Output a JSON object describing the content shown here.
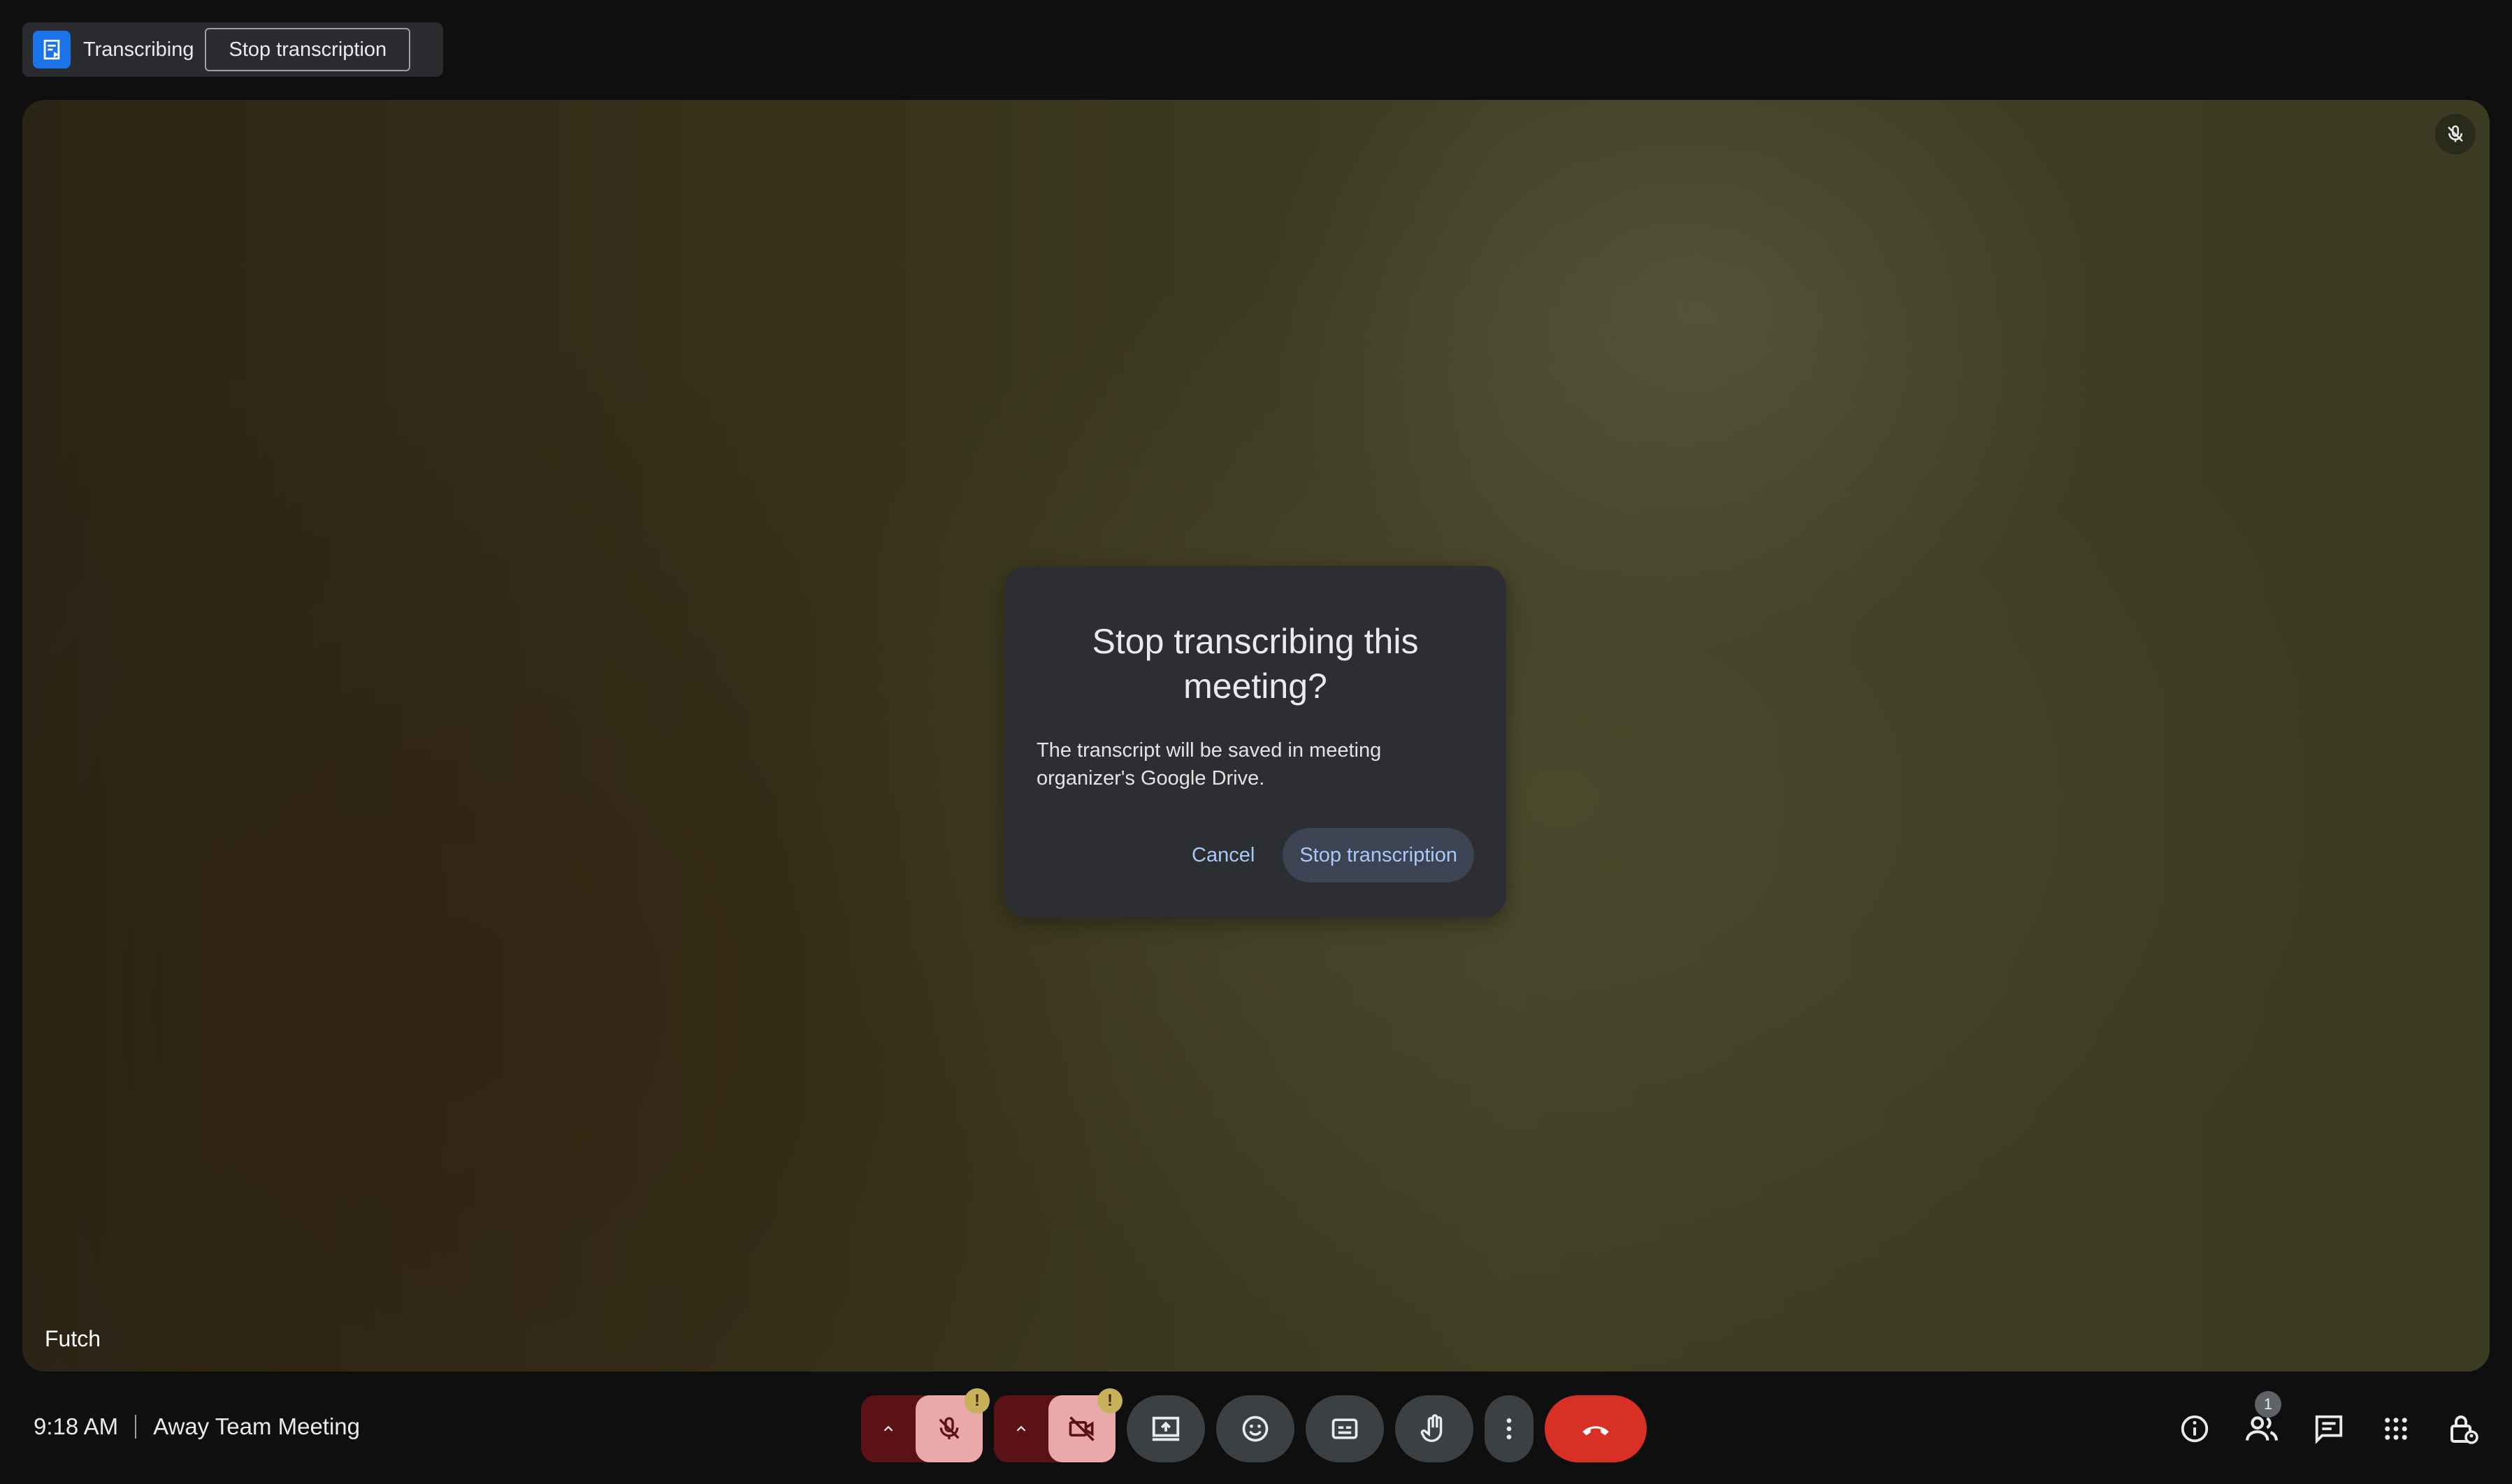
{
  "transcribing_bar": {
    "status_label": "Transcribing",
    "stop_button_label": "Stop transcription",
    "icon": "transcript-icon"
  },
  "stage": {
    "participant_name": "Futch",
    "mic_status_icon": "mic-off-icon"
  },
  "dialog": {
    "title": "Stop transcribing this meeting?",
    "body": "The transcript will be saved in meeting organizer's Google Drive.",
    "cancel_label": "Cancel",
    "confirm_label": "Stop transcription"
  },
  "bottom_bar": {
    "time": "9:18 AM",
    "meeting_name": "Away Team Meeting",
    "warning_symbol": "!",
    "controls": [
      {
        "name": "mic-options",
        "icon": "chevron-up-icon"
      },
      {
        "name": "microphone",
        "icon": "mic-off-icon",
        "state": "off"
      },
      {
        "name": "camera-options",
        "icon": "chevron-up-icon"
      },
      {
        "name": "camera",
        "icon": "camera-off-icon",
        "state": "off"
      },
      {
        "name": "present",
        "icon": "present-screen-icon"
      },
      {
        "name": "reactions",
        "icon": "emoji-icon"
      },
      {
        "name": "captions",
        "icon": "captions-icon"
      },
      {
        "name": "raise-hand",
        "icon": "hand-icon"
      },
      {
        "name": "more-options",
        "icon": "more-vert-icon"
      },
      {
        "name": "leave-call",
        "icon": "call-end-icon"
      }
    ],
    "right_icons": [
      "info-icon",
      "people-icon",
      "chat-icon",
      "apps-icon",
      "host-controls-icon"
    ],
    "people_count": "1"
  },
  "colors": {
    "accent_blue": "#a8c7fa",
    "hangup_red": "#d93025",
    "muted_pink": "#e9a9a9",
    "warning_yellow": "#c9b05a"
  }
}
